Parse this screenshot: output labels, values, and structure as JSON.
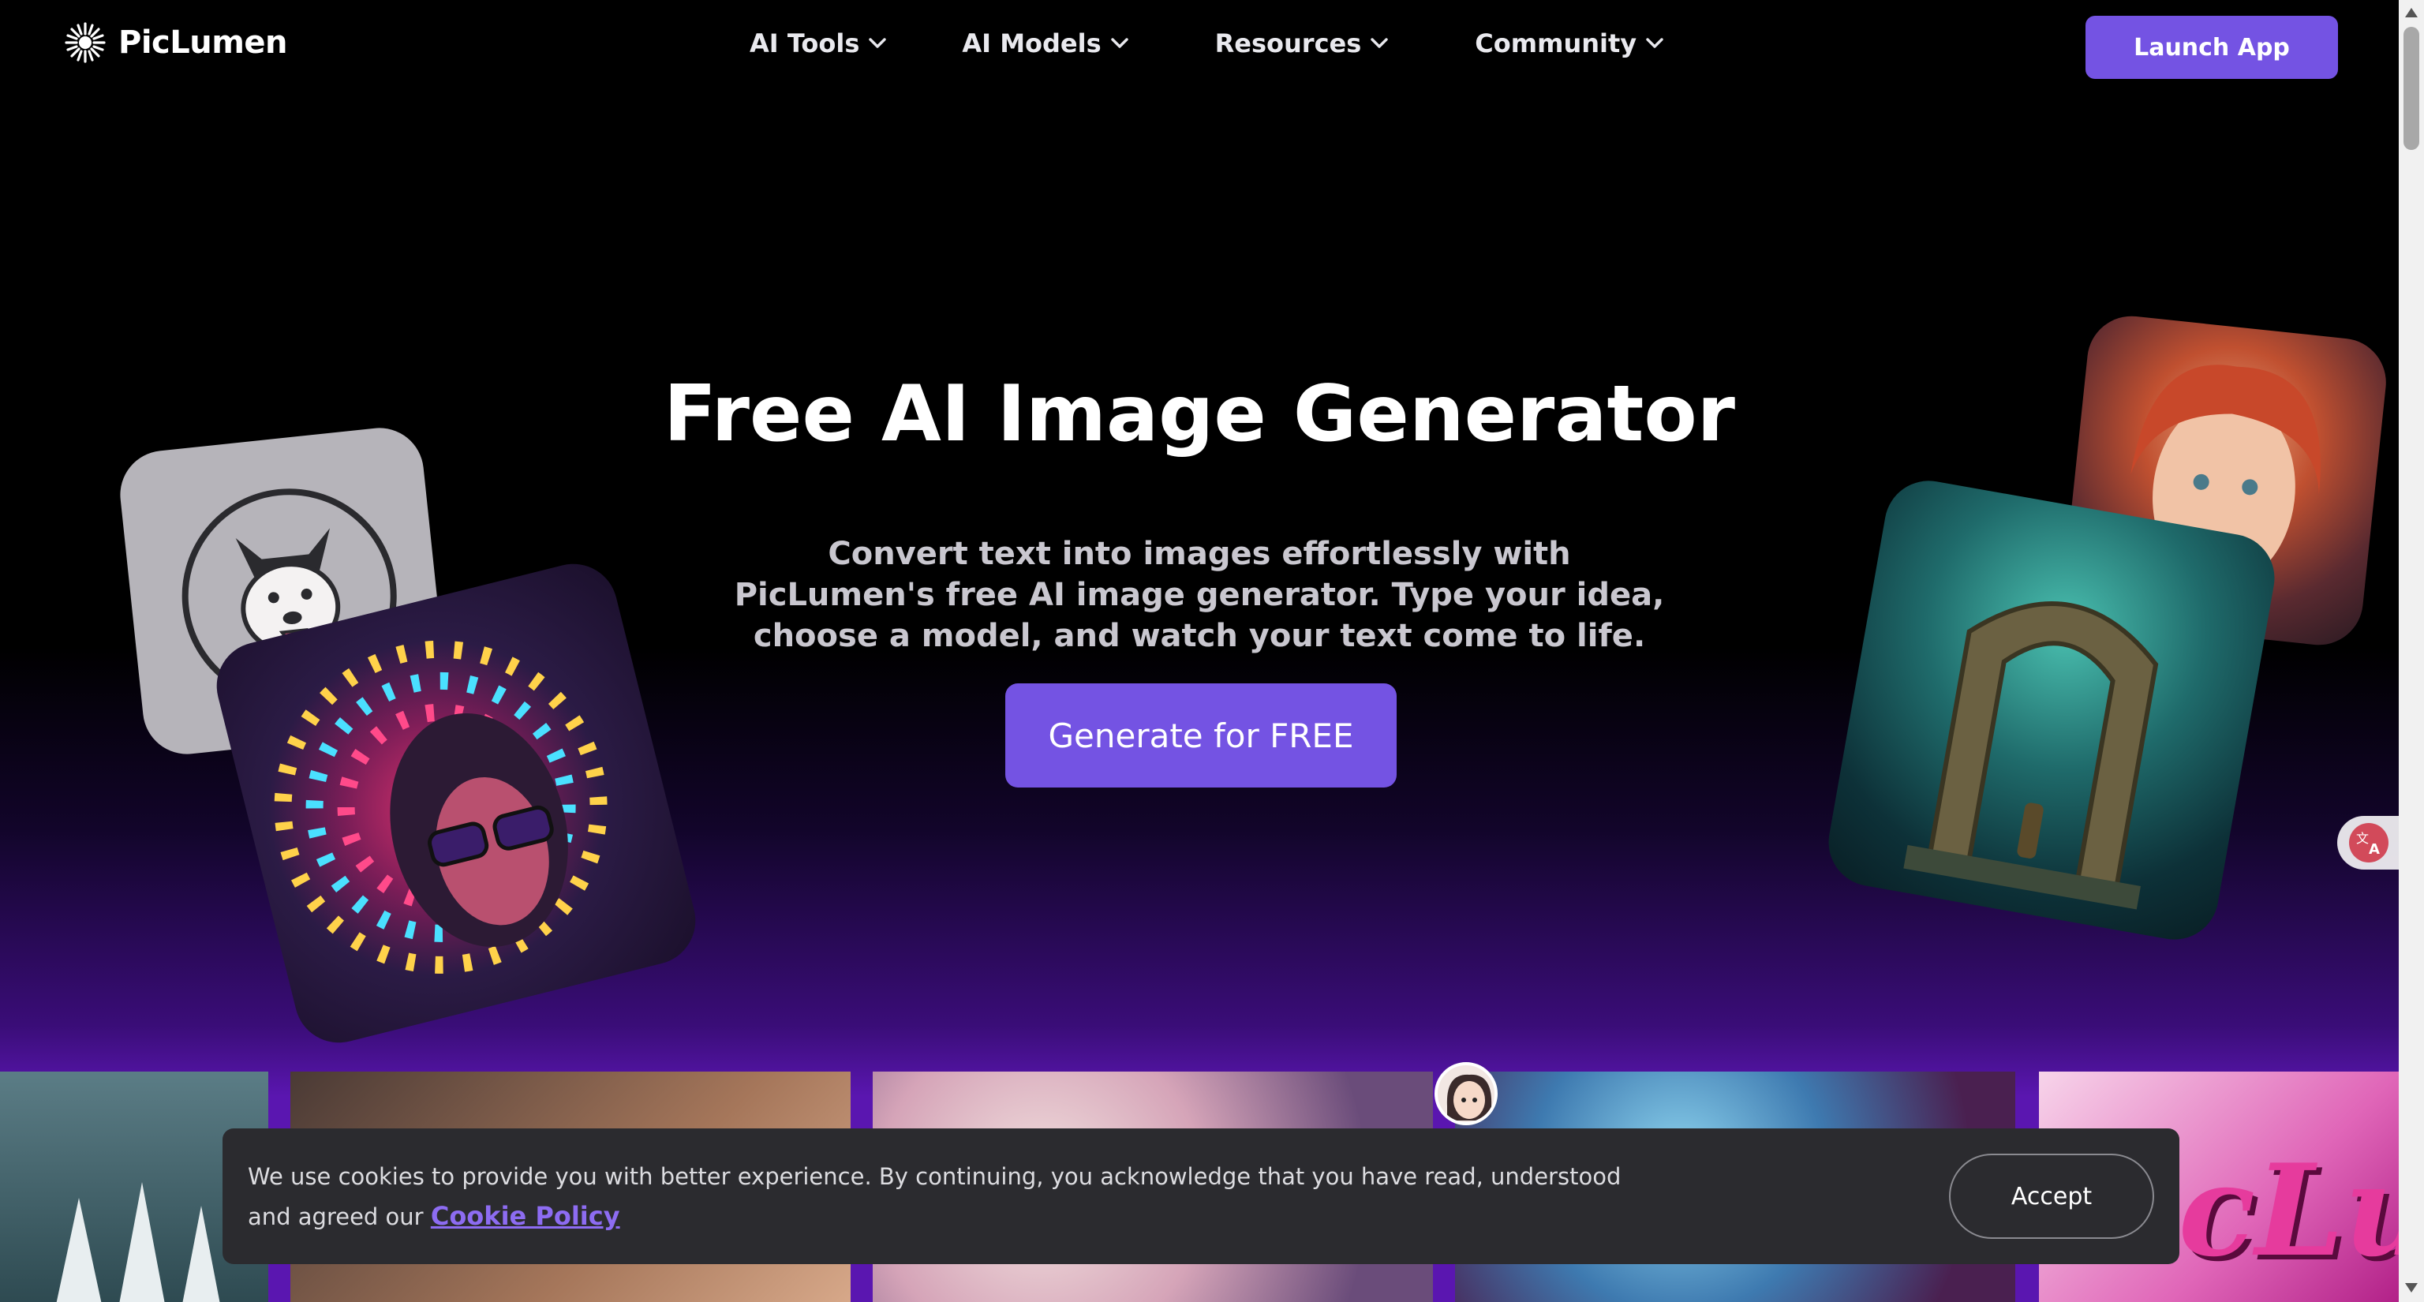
{
  "brand": {
    "name": "PicLumen"
  },
  "nav": {
    "items": [
      {
        "label": "AI Tools"
      },
      {
        "label": "AI Models"
      },
      {
        "label": "Resources"
      },
      {
        "label": "Community"
      }
    ],
    "launch_label": "Launch App"
  },
  "hero": {
    "title": "Free AI Image Generator",
    "subtitle": "Convert text into images effortlessly with PicLumen's free AI image generator. Type your idea, choose a model, and watch your text come to life.",
    "cta_label": "Generate for FREE"
  },
  "gallery": {
    "last_tile_text": "icLun"
  },
  "cookie": {
    "text": "We use cookies to provide you with better experience. By continuing, you acknowledge that you have read, understood and agreed our",
    "link_label": "Cookie Policy",
    "accept_label": "Accept"
  },
  "colors": {
    "accent": "#7453e3",
    "link": "#8d6cf2",
    "cookie_bg": "#2b2b2f"
  },
  "icons": [
    "piclumen-logo-icon",
    "chevron-down-icon",
    "translate-icon"
  ]
}
